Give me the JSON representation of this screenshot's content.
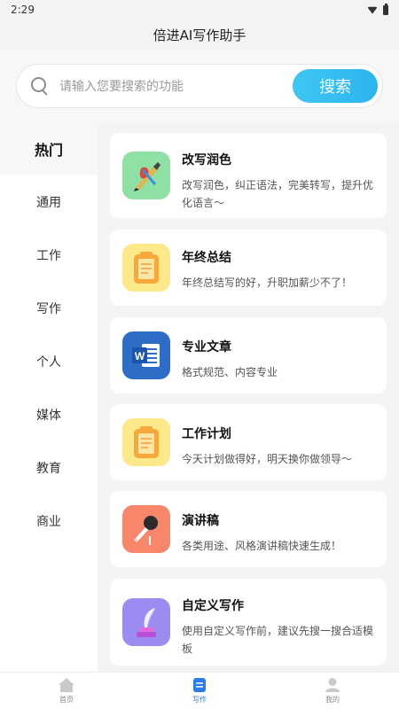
{
  "status_bar": {
    "time": "2:29"
  },
  "header": {
    "title": "倍进AI写作助手"
  },
  "search": {
    "placeholder": "请输入您要搜索的功能",
    "button_label": "搜索"
  },
  "sidebar": {
    "items": [
      {
        "label": "热门",
        "active": true
      },
      {
        "label": "通用"
      },
      {
        "label": "工作"
      },
      {
        "label": "写作"
      },
      {
        "label": "个人"
      },
      {
        "label": "媒体"
      },
      {
        "label": "教育"
      },
      {
        "label": "商业"
      }
    ]
  },
  "cards": [
    {
      "title": "改写润色",
      "desc": "改写润色，纠正语法，完美转写，提升优化语言～",
      "icon": "pen-brush-icon"
    },
    {
      "title": "年终总结",
      "desc": "年终总结写的好，升职加薪少不了！",
      "icon": "clipboard-icon"
    },
    {
      "title": "专业文章",
      "desc": "格式规范、内容专业",
      "icon": "word-document-icon"
    },
    {
      "title": "工作计划",
      "desc": "今天计划做得好，明天换你做领导～",
      "icon": "clipboard-icon"
    },
    {
      "title": "演讲稿",
      "desc": "各类用途、风格演讲稿快速生成！",
      "icon": "microphone-icon"
    },
    {
      "title": "自定义写作",
      "desc": "使用自定义写作前，建议先搜一搜合适模板",
      "icon": "quill-ink-icon"
    }
  ],
  "bottom_nav": {
    "items": [
      {
        "label": "首页",
        "icon": "home-icon"
      },
      {
        "label": "写作",
        "icon": "document-icon",
        "active": true
      },
      {
        "label": "我的",
        "icon": "user-icon"
      }
    ]
  },
  "colors": {
    "accent": "#2ab5ee",
    "nav_active": "#2a7ee8"
  }
}
